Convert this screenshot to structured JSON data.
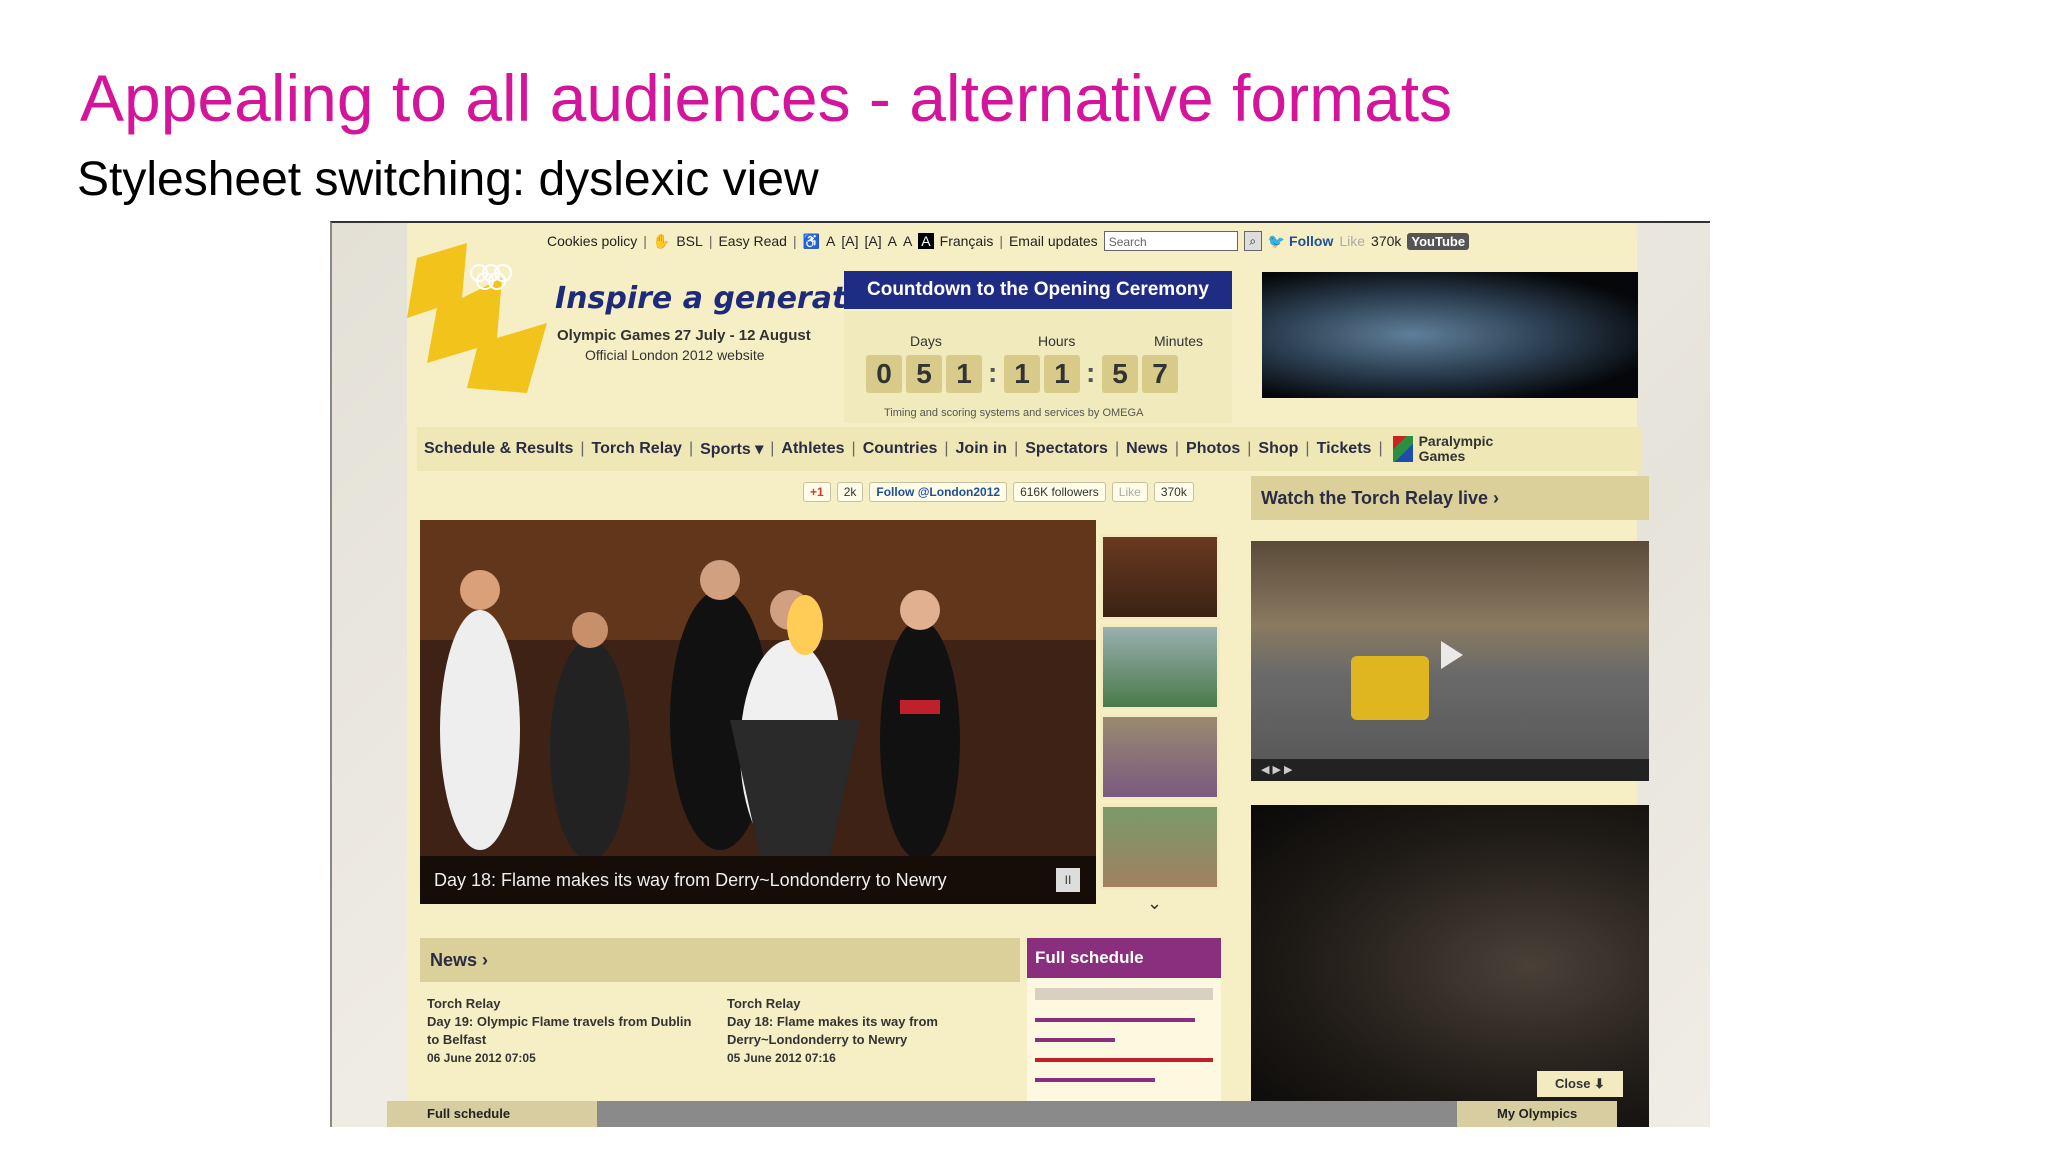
{
  "slide": {
    "title": "Appealing to all audiences - alternative formats",
    "subtitle": "Stylesheet switching: dyslexic view"
  },
  "site": {
    "utility": {
      "cookies": "Cookies policy",
      "bsl": "BSL",
      "easy_read": "Easy Read",
      "text_size_a1": "A",
      "text_size_a2": "[A]",
      "text_size_a3": "[A]",
      "contrast_a1": "A",
      "contrast_a2": "A",
      "francais": "Français",
      "email_updates": "Email updates",
      "search_placeholder": "Search",
      "follow": "Follow",
      "like": "Like",
      "like_count": "370k",
      "youtube": "YouTube"
    },
    "header": {
      "tagline": "Inspire a generation",
      "dates": "Olympic Games 27 July - 12 August",
      "official": "Official London 2012 website"
    },
    "countdown": {
      "title": "Countdown to the Opening Ceremony",
      "days_label": "Days",
      "hours_label": "Hours",
      "minutes_label": "Minutes",
      "d1": "0",
      "d2": "5",
      "d3": "1",
      "h1": "1",
      "h2": "1",
      "m1": "5",
      "m2": "7",
      "footer": "Timing and scoring systems and services by OMEGA"
    },
    "nav": {
      "items": [
        "Schedule & Results",
        "Torch Relay",
        "Sports ▾",
        "Athletes",
        "Countries",
        "Join in",
        "Spectators",
        "News",
        "Photos",
        "Shop",
        "Tickets"
      ],
      "paralympic_1": "Paralympic",
      "paralympic_2": "Games"
    },
    "social": {
      "gplus": "+1",
      "gplus_count": "2k",
      "follow_handle": "Follow @London2012",
      "followers": "616K followers",
      "like": "Like",
      "like_count": "370k"
    },
    "hero": {
      "caption": "Day 18: Flame makes its way from Derry~Londonderry to Newry",
      "pause": "II"
    },
    "torch": {
      "heading": "Watch the Torch Relay live ›"
    },
    "news": {
      "heading": "News ›",
      "items": [
        {
          "category": "Torch Relay",
          "title": "Day 19: Olympic Flame travels from Dublin to Belfast",
          "date": "06 June 2012 07:05"
        },
        {
          "category": "Torch Relay",
          "title": "Day 18: Flame makes its way from Derry~Londonderry to Newry",
          "date": "05 June 2012 07:16"
        }
      ]
    },
    "schedule": {
      "heading": "Full schedule"
    },
    "bottom": {
      "close": "Close ⬇",
      "full_schedule": "Full schedule",
      "my_olympics": "My Olympics"
    }
  },
  "colors": {
    "title": "#d4149a",
    "page_bg": "#f6efc6",
    "countdown_bg": "#1f2c84",
    "schedule_bg": "#8a2e7e"
  }
}
